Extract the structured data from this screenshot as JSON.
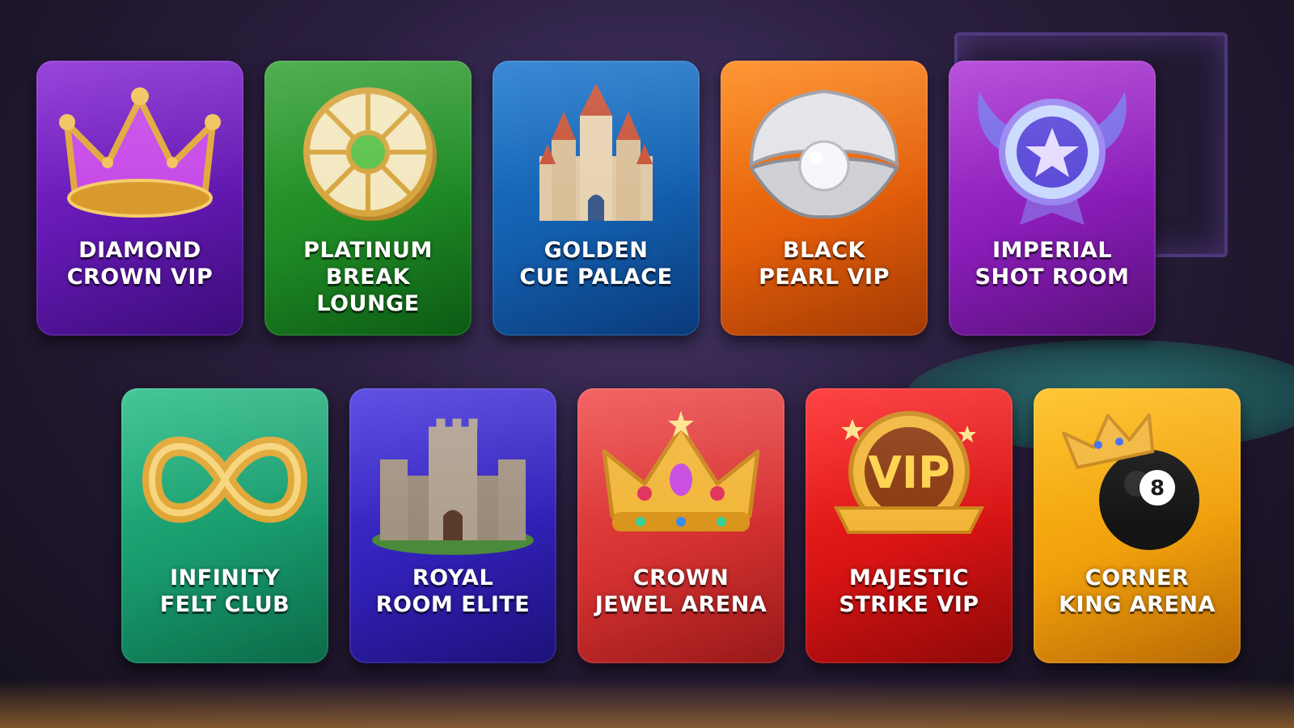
{
  "rooms": [
    {
      "line1": "DIAMOND",
      "line2": "CROWN VIP",
      "icon": "crown-icon",
      "color": "#6218b0"
    },
    {
      "line1": "PLATINUM",
      "line2": "BREAK LOUNGE",
      "icon": "wheel-icon",
      "color": "#1f8a25"
    },
    {
      "line1": "GOLDEN",
      "line2": "CUE PALACE",
      "icon": "castle-icon",
      "color": "#135fae"
    },
    {
      "line1": "BLACK",
      "line2": "PEARL VIP",
      "icon": "pearl-shell-icon",
      "color": "#e35e0a"
    },
    {
      "line1": "IMPERIAL",
      "line2": "SHOT ROOM",
      "icon": "winged-medal-icon",
      "color": "#8a1db8"
    },
    {
      "line1": "INFINITY",
      "line2": "FELT CLUB",
      "icon": "infinity-icon",
      "color": "#189a6c"
    },
    {
      "line1": "ROYAL",
      "line2": "ROOM ELITE",
      "icon": "fortress-icon",
      "color": "#3221b8"
    },
    {
      "line1": "CROWN",
      "line2": "JEWEL ARENA",
      "icon": "jeweled-crown-icon",
      "color": "#d63232"
    },
    {
      "line1": "MAJESTIC",
      "line2": "STRIKE VIP",
      "icon": "vip-badge-icon",
      "color": "#d81414"
    },
    {
      "line1": "CORNER",
      "line2": "KING ARENA",
      "icon": "crowned-8-ball-icon",
      "color": "#f0a00c"
    }
  ]
}
